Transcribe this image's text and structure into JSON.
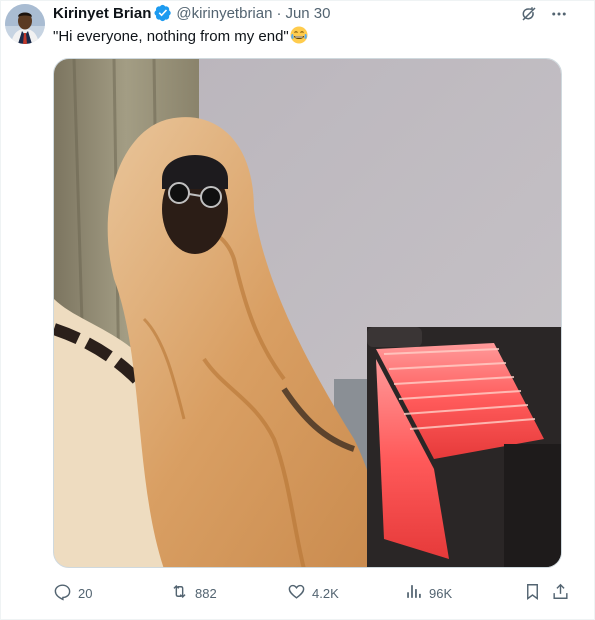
{
  "tweet": {
    "display_name": "Kirinyet Brian",
    "handle": "@kirinyetbrian",
    "separator": "·",
    "date": "Jun 30",
    "text": "\"Hi everyone, nothing from my end\"",
    "emoji_icon": "face-with-tears-of-joy-icon",
    "verified_color": "#1d9bf0"
  },
  "top_icons": [
    "grok-icon",
    "more-icon"
  ],
  "media": {
    "alt_icon": "photo-of-person-wrapped-in-blanket-by-heater"
  },
  "actions": {
    "replies": "20",
    "reposts": "882",
    "likes": "4.2K",
    "views": "96K"
  },
  "colors": {
    "text_primary": "#0f1419",
    "text_secondary": "#536471",
    "accent": "#1d9bf0"
  }
}
